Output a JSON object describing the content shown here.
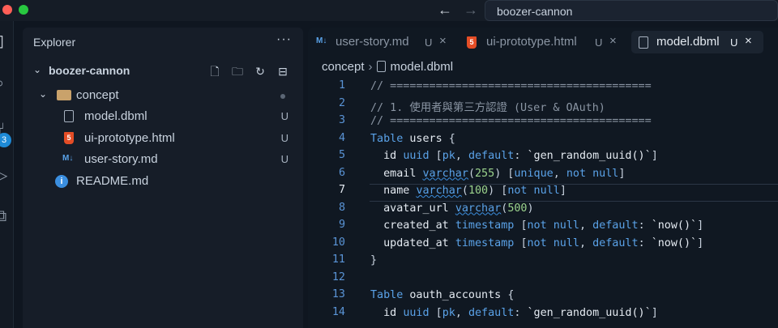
{
  "window": {
    "command_center_text": "boozer-cannon"
  },
  "activity": {
    "scm_badge": "3"
  },
  "sidebar": {
    "title": "Explorer",
    "more_label": "···",
    "project": "boozer-cannon",
    "folder": "concept",
    "files": [
      {
        "name": "model.dbml",
        "status": "U"
      },
      {
        "name": "ui-prototype.html",
        "status": "U"
      },
      {
        "name": "user-story.md",
        "status": "U"
      }
    ],
    "readme": "README.md"
  },
  "editor": {
    "tabs": [
      {
        "icon": "M↓",
        "label": "user-story.md",
        "status": "U",
        "close": "×"
      },
      {
        "icon": "5",
        "label": "ui-prototype.html",
        "status": "U",
        "close": "×"
      },
      {
        "icon": "",
        "label": "model.dbml",
        "status": "U",
        "close": "×"
      }
    ],
    "breadcrumb": {
      "folder": "concept",
      "sep": "›",
      "file": "model.dbml"
    },
    "current_line": 7,
    "lines": [
      {
        "n": "1",
        "t": [
          [
            "cmt",
            "// ========================================"
          ]
        ]
      },
      {
        "n": "2",
        "t": [
          [
            "cmt",
            "// 1. 使用者與第三方認證 (User & OAuth)"
          ]
        ]
      },
      {
        "n": "3",
        "t": [
          [
            "cmt",
            "// ========================================"
          ]
        ]
      },
      {
        "n": "4",
        "t": [
          [
            "kw",
            "Table "
          ],
          [
            "id",
            "users "
          ],
          [
            "pn",
            "{"
          ]
        ]
      },
      {
        "n": "5",
        "t": [
          [
            "id",
            "  id "
          ],
          [
            "ty",
            "uuid "
          ],
          [
            "pn",
            "["
          ],
          [
            "kw",
            "pk"
          ],
          [
            "pn",
            ", "
          ],
          [
            "kw",
            "default"
          ],
          [
            "pn",
            ": "
          ],
          [
            "str",
            "`gen_random_uuid()`"
          ],
          [
            "pn",
            "]"
          ]
        ]
      },
      {
        "n": "6",
        "t": [
          [
            "id",
            "  email "
          ],
          [
            "ty sq",
            "varchar"
          ],
          [
            "pn",
            "("
          ],
          [
            "nm",
            "255"
          ],
          [
            "pn",
            ") ["
          ],
          [
            "kw",
            "unique"
          ],
          [
            "pn",
            ", "
          ],
          [
            "kw",
            "not null"
          ],
          [
            "pn",
            "]"
          ]
        ]
      },
      {
        "n": "7",
        "t": [
          [
            "id",
            "  name "
          ],
          [
            "ty sq",
            "varchar"
          ],
          [
            "pn",
            "("
          ],
          [
            "nm",
            "100"
          ],
          [
            "pn",
            ") ["
          ],
          [
            "kw",
            "not null"
          ],
          [
            "pn",
            "]"
          ]
        ]
      },
      {
        "n": "8",
        "t": [
          [
            "id",
            "  avatar_url "
          ],
          [
            "ty sq",
            "varchar"
          ],
          [
            "pn",
            "("
          ],
          [
            "nm",
            "500"
          ],
          [
            "pn",
            ")"
          ]
        ]
      },
      {
        "n": "9",
        "t": [
          [
            "id",
            "  created_at "
          ],
          [
            "ty",
            "timestamp "
          ],
          [
            "pn",
            "["
          ],
          [
            "kw",
            "not null"
          ],
          [
            "pn",
            ", "
          ],
          [
            "kw",
            "default"
          ],
          [
            "pn",
            ": "
          ],
          [
            "str",
            "`now()`"
          ],
          [
            "pn",
            "]"
          ]
        ]
      },
      {
        "n": "10",
        "t": [
          [
            "id",
            "  updated_at "
          ],
          [
            "ty",
            "timestamp "
          ],
          [
            "pn",
            "["
          ],
          [
            "kw",
            "not null"
          ],
          [
            "pn",
            ", "
          ],
          [
            "kw",
            "default"
          ],
          [
            "pn",
            ": "
          ],
          [
            "str",
            "`now()`"
          ],
          [
            "pn",
            "]"
          ]
        ]
      },
      {
        "n": "11",
        "t": [
          [
            "pn",
            "}"
          ]
        ]
      },
      {
        "n": "12",
        "t": []
      },
      {
        "n": "13",
        "t": [
          [
            "kw",
            "Table "
          ],
          [
            "id",
            "oauth_accounts "
          ],
          [
            "pn",
            "{"
          ]
        ]
      },
      {
        "n": "14",
        "t": [
          [
            "id",
            "  id "
          ],
          [
            "ty",
            "uuid "
          ],
          [
            "pn",
            "["
          ],
          [
            "kw",
            "pk"
          ],
          [
            "pn",
            ", "
          ],
          [
            "kw",
            "default"
          ],
          [
            "pn",
            ": "
          ],
          [
            "str",
            "`gen_random_uuid()`"
          ],
          [
            "pn",
            "]"
          ]
        ]
      }
    ]
  },
  "colors": {
    "accent": "#3b8fe0",
    "html_icon": "#e44d26",
    "close_red": "#ff5f57",
    "green": "#28c840"
  }
}
